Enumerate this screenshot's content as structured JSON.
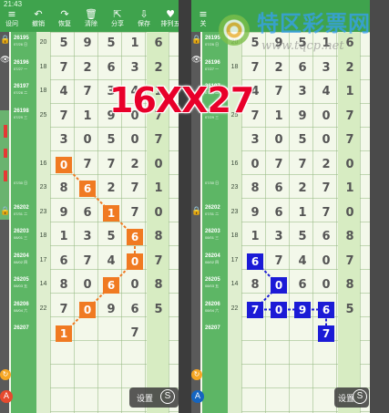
{
  "status_time": "21:43",
  "toolbar_items": [
    {
      "icon": "≡",
      "label": "设问",
      "name": "menu"
    },
    {
      "icon": "↶",
      "label": "撤销",
      "name": "undo"
    },
    {
      "icon": "↷",
      "label": "恢复",
      "name": "redo"
    },
    {
      "icon": "🗑",
      "label": "清除",
      "name": "clear"
    },
    {
      "icon": "⇱",
      "label": "分享",
      "name": "share"
    },
    {
      "icon": "⇩",
      "label": "保存",
      "name": "save"
    },
    {
      "icon": "♥",
      "label": "排列五",
      "name": "pl5"
    }
  ],
  "right_toolbar_first_label": "关",
  "issues": [
    {
      "no": "26195",
      "date": "07/26 日"
    },
    {
      "no": "26196",
      "date": "07/27 一"
    },
    {
      "no": "26197",
      "date": "07/28 二"
    },
    {
      "no": "26198",
      "date": "07/29 三"
    },
    {
      "no": "",
      "date": ""
    },
    {
      "no": "",
      "date": ""
    },
    {
      "no": "",
      "date": "07/30 日"
    },
    {
      "no": "26202",
      "date": "07/31 二"
    },
    {
      "no": "26203",
      "date": "08/01 三"
    },
    {
      "no": "26204",
      "date": "08/02 四"
    },
    {
      "no": "26205",
      "date": "08/03 五"
    },
    {
      "no": "26206",
      "date": "08/04 六"
    },
    {
      "no": "26207",
      "date": ""
    }
  ],
  "tails": [
    "20",
    "18",
    "18",
    "25",
    "",
    "16",
    "23",
    "23",
    "18",
    "17",
    "14",
    "22",
    ""
  ],
  "grid_rows": [
    [
      "5",
      "9",
      "5",
      "1",
      "6"
    ],
    [
      "7",
      "2",
      "6",
      "3",
      "2"
    ],
    [
      "4",
      "7",
      "3",
      "4",
      "1"
    ],
    [
      "7",
      "1",
      "9",
      "0",
      "7"
    ],
    [
      "3",
      "0",
      "5",
      "0",
      "7"
    ],
    [
      "0",
      "7",
      "7",
      "2",
      "0"
    ],
    [
      "8",
      "6",
      "2",
      "7",
      "1"
    ],
    [
      "9",
      "6",
      "1",
      "7",
      "0"
    ],
    [
      "1",
      "3",
      "5",
      "6",
      "8"
    ],
    [
      "6",
      "7",
      "4",
      "0",
      "7"
    ],
    [
      "8",
      "0",
      "6",
      "0",
      "8"
    ],
    [
      "7",
      "0",
      "9",
      "6",
      "5"
    ],
    [
      "",
      "",
      "",
      "7",
      ""
    ]
  ],
  "left_highlights": [
    {
      "row": 5,
      "col": 0,
      "value": "0"
    },
    {
      "row": 6,
      "col": 1,
      "value": "6"
    },
    {
      "row": 7,
      "col": 2,
      "value": "1"
    },
    {
      "row": 8,
      "col": 3,
      "value": "6"
    },
    {
      "row": 9,
      "col": 3,
      "value": "0"
    },
    {
      "row": 10,
      "col": 2,
      "value": "6"
    },
    {
      "row": 11,
      "col": 1,
      "value": "0"
    },
    {
      "row": 12,
      "col": 0,
      "value": "1"
    }
  ],
  "right_highlights": [
    {
      "row": 9,
      "col": 0,
      "value": "6"
    },
    {
      "row": 10,
      "col": 1,
      "value": "0"
    },
    {
      "row": 11,
      "col": 0,
      "value": "7"
    },
    {
      "row": 11,
      "col": 1,
      "value": "0"
    },
    {
      "row": 11,
      "col": 2,
      "value": "9"
    },
    {
      "row": 11,
      "col": 3,
      "value": "6"
    },
    {
      "row": 12,
      "col": 3,
      "value": "7"
    }
  ],
  "overlay_text": "16XX27",
  "watermark": {
    "title": "特区彩票网",
    "url": "www.tqcp.net"
  },
  "settings_label": "设置",
  "settings_icon_text": "S",
  "colors": {
    "toolbar": "#3fa34d",
    "issue_column": "#5db665",
    "left_highlight": "#f07a22",
    "right_highlight": "#1b1bd6",
    "overlay": "#e8002a"
  }
}
